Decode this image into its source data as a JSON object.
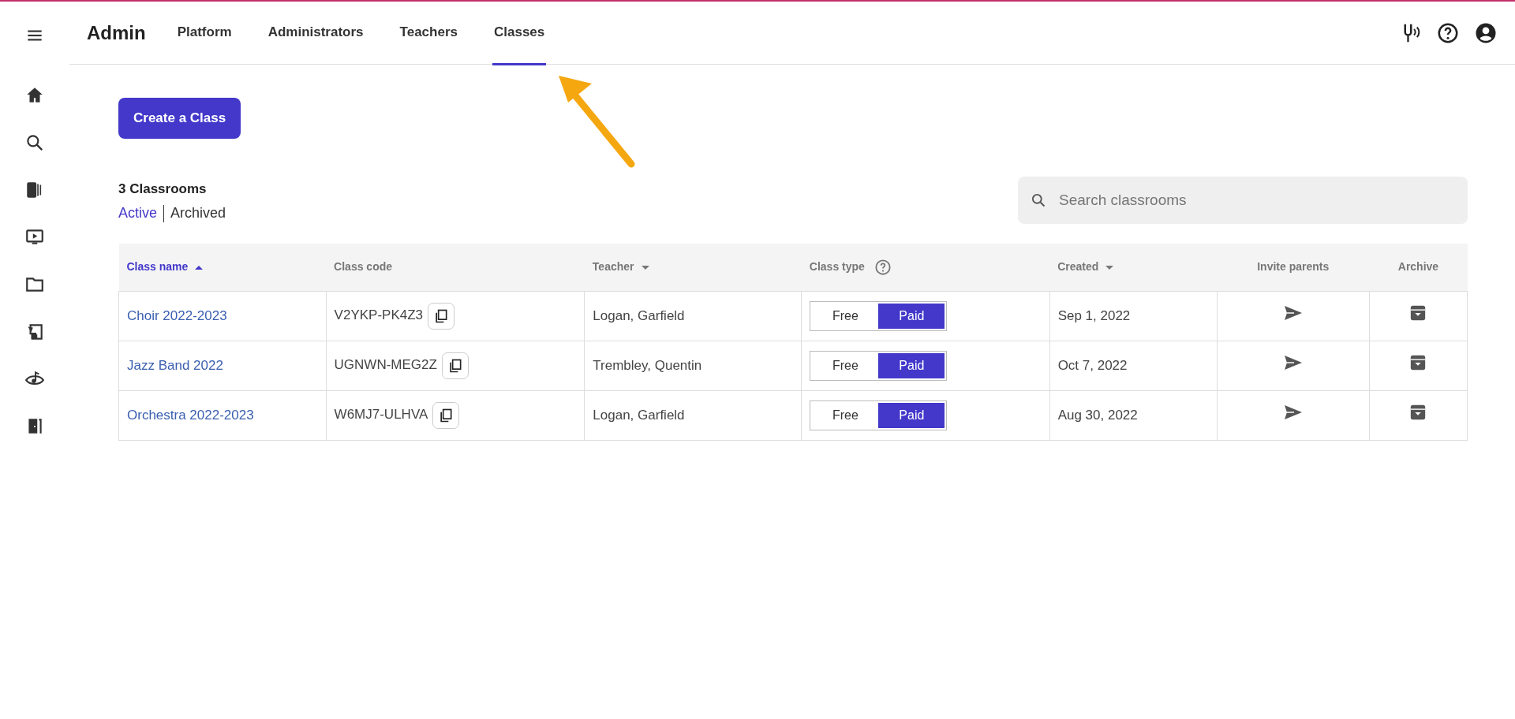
{
  "header": {
    "title": "Admin",
    "tabs": [
      {
        "label": "Platform",
        "selected": false
      },
      {
        "label": "Administrators",
        "selected": false
      },
      {
        "label": "Teachers",
        "selected": false
      },
      {
        "label": "Classes",
        "selected": true
      }
    ]
  },
  "create_button": "Create a Class",
  "count": "3 Classrooms",
  "filters": [
    {
      "label": "Active",
      "selected": true
    },
    {
      "label": "Archived",
      "selected": false
    }
  ],
  "search": {
    "placeholder": "Search classrooms"
  },
  "table": {
    "columns": [
      {
        "label": "Class name",
        "kind": "sort",
        "selected": true,
        "ascending": true
      },
      {
        "label": "Class code",
        "kind": "plain",
        "selected": false
      },
      {
        "label": "Teacher",
        "kind": "sort",
        "selected": false,
        "ascending": false
      },
      {
        "label": "Class type",
        "kind": "help",
        "selected": false
      },
      {
        "label": "Created",
        "kind": "sort",
        "selected": false,
        "ascending": false
      },
      {
        "label": "Invite parents",
        "kind": "plain",
        "selected": false
      },
      {
        "label": "Archive",
        "kind": "plain",
        "selected": false
      }
    ],
    "rows": [
      {
        "name": "Choir 2022-2023",
        "code": "V2YKP-PK4Z3",
        "teacher": "Logan, Garfield",
        "types": [
          {
            "label": "Free",
            "selected": false
          },
          {
            "label": "Paid",
            "selected": true
          }
        ],
        "created": "Sep 1, 2022"
      },
      {
        "name": "Jazz Band 2022",
        "code": "UGNWN-MEG2Z",
        "teacher": "Trembley, Quentin",
        "types": [
          {
            "label": "Free",
            "selected": false
          },
          {
            "label": "Paid",
            "selected": true
          }
        ],
        "created": "Oct 7, 2022"
      },
      {
        "name": "Orchestra 2022-2023",
        "code": "W6MJ7-ULHVA",
        "teacher": "Logan, Garfield",
        "types": [
          {
            "label": "Free",
            "selected": false
          },
          {
            "label": "Paid",
            "selected": true
          }
        ],
        "created": "Aug 30, 2022"
      }
    ]
  }
}
